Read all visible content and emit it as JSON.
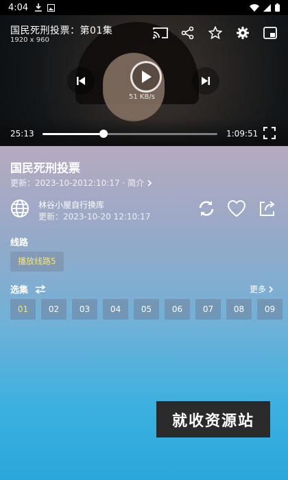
{
  "status_bar": {
    "time": "4:04",
    "icons": [
      "download-icon",
      "image-icon",
      "wifi-icon",
      "signal-icon",
      "battery-icon"
    ]
  },
  "player": {
    "title": "国民死刑投票：第01集",
    "resolution": "1920 x 960",
    "speed": "51 KB/s",
    "current_time": "25:13",
    "total_time": "1:09:51",
    "progress": 0.35,
    "tools": [
      "cast-icon",
      "share-icon",
      "star-icon",
      "gear-icon",
      "pip-icon"
    ]
  },
  "info": {
    "title": "国民死刑投票",
    "update_line": "更新：2023-10-2012:10:17 · 简介",
    "source_name": "林谷小屋自行换库",
    "source_update": "更新：2023-10-20 12:10:17"
  },
  "route": {
    "label": "线路",
    "chip": "播放线路5"
  },
  "episodes": {
    "label": "选集",
    "more": "更多",
    "items": [
      "01",
      "02",
      "03",
      "04",
      "05",
      "06",
      "07",
      "08",
      "09"
    ],
    "active_index": 0
  },
  "watermark": {
    "text": "就收资源站"
  },
  "colors": {
    "accent_yellow": "#f7e36a"
  }
}
